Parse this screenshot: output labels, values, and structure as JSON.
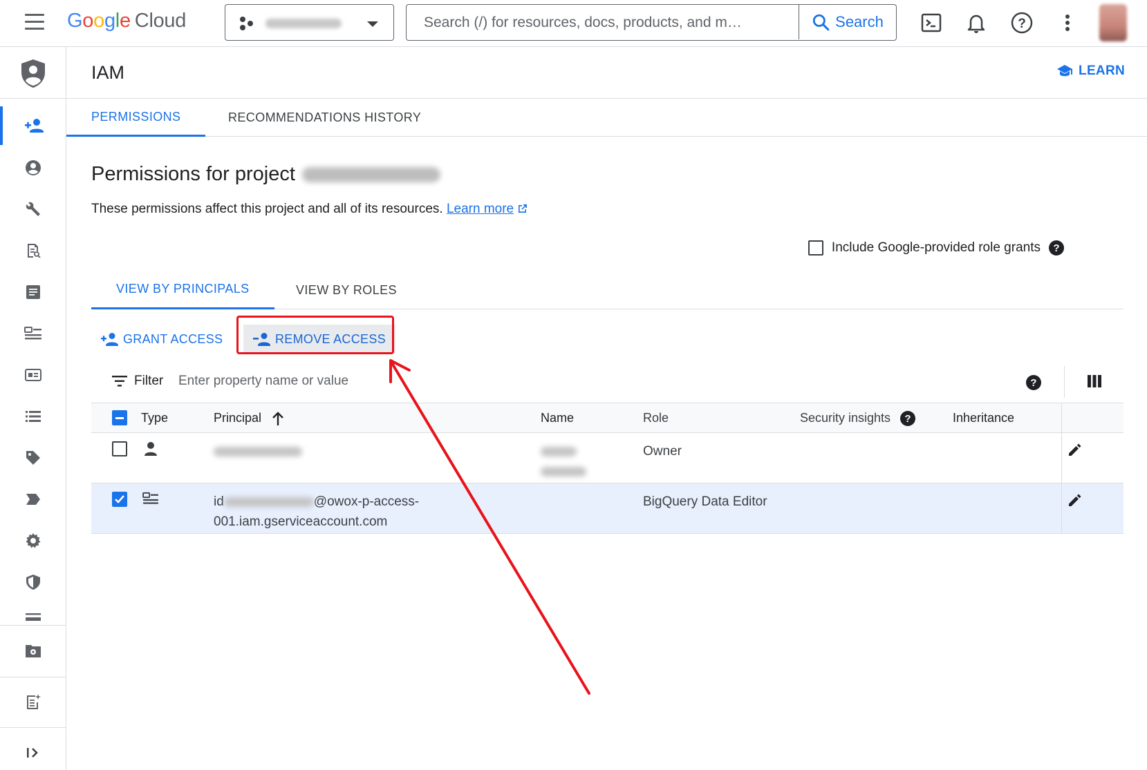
{
  "topbar": {
    "logo_google": [
      "G",
      "o",
      "o",
      "g",
      "l",
      "e"
    ],
    "logo_cloud": "Cloud",
    "search_placeholder": "Search (/) for resources, docs, products, and m…",
    "search_button": "Search"
  },
  "header": {
    "title": "IAM",
    "learn_label": "LEARN"
  },
  "tabs": {
    "permissions": "PERMISSIONS",
    "recommendations": "RECOMMENDATIONS HISTORY"
  },
  "section": {
    "title_prefix": "Permissions for project",
    "description": "These permissions affect this project and all of its resources.",
    "learn_more": "Learn more",
    "include_label": "Include Google-provided role grants"
  },
  "view_tabs": {
    "principals": "VIEW BY PRINCIPALS",
    "roles": "VIEW BY ROLES"
  },
  "actions": {
    "grant": "GRANT ACCESS",
    "remove": "REMOVE ACCESS"
  },
  "filter": {
    "label": "Filter",
    "placeholder": "Enter property name or value"
  },
  "table": {
    "headers": {
      "type": "Type",
      "principal": "Principal",
      "name": "Name",
      "role": "Role",
      "security": "Security insights",
      "inheritance": "Inheritance"
    },
    "rows": [
      {
        "selected": false,
        "type_icon": "person-icon",
        "principal_line1": "",
        "principal_line2": "",
        "role": "Owner"
      },
      {
        "selected": true,
        "type_icon": "service-account-icon",
        "principal_prefix": "id",
        "principal_suffix": "@owox-p-access-",
        "principal_line2": "001.iam.gserviceaccount.com",
        "role": "BigQuery Data Editor"
      }
    ]
  },
  "colors": {
    "accent": "#1a73e8",
    "highlight": "#e8131b",
    "selected_row": "#e8f0fe"
  }
}
